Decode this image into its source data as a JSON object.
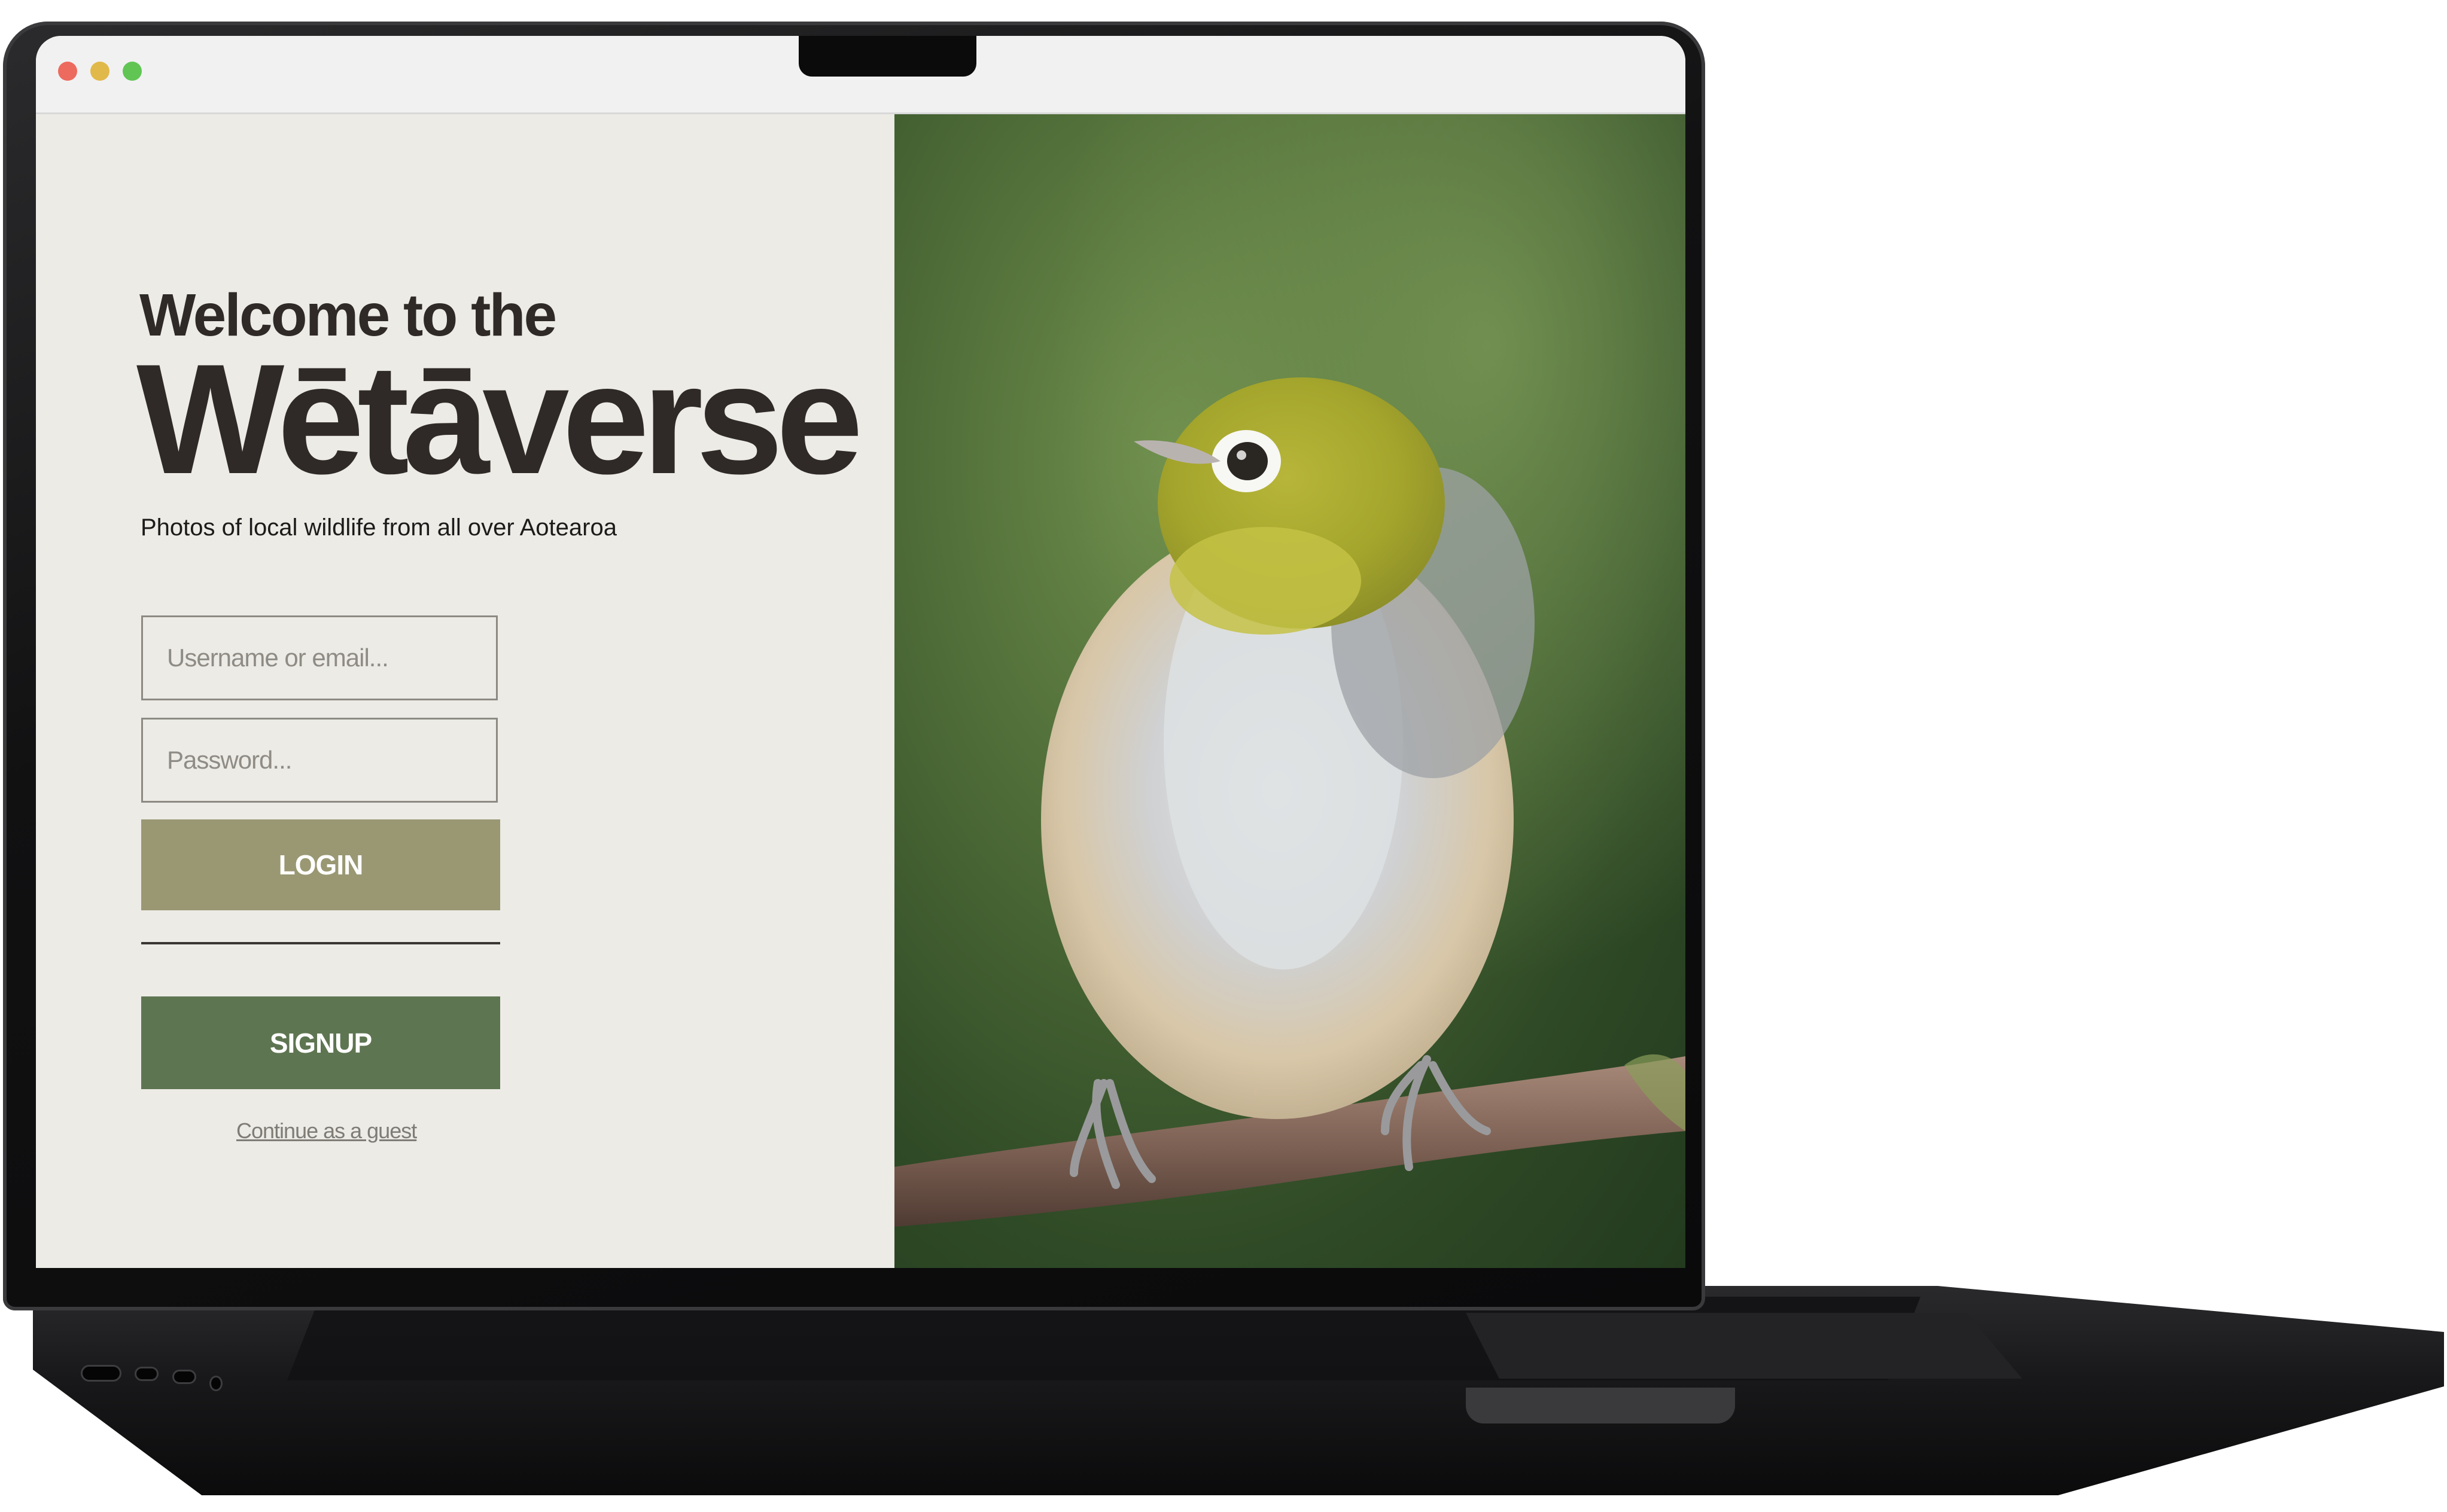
{
  "window": {
    "controls": [
      "close",
      "minimize",
      "maximize"
    ],
    "colors": {
      "close": "#ed6a5e",
      "minimize": "#e1b94a",
      "maximize": "#61c554"
    }
  },
  "login_panel": {
    "welcome_line": "Welcome to the",
    "brand_title": "Wētāverse",
    "tagline": "Photos of local wildlife from all over Aotearoa",
    "username_placeholder": "Username or email...",
    "password_placeholder": "Password...",
    "login_label": "LOGIN",
    "signup_label": "SIGNUP",
    "guest_link": "Continue as a guest"
  },
  "photo_panel": {
    "subject": "bird-on-branch"
  },
  "colors": {
    "panel_background": "#ecebe6",
    "text_dark": "#2f2a27",
    "login_button": "#999873",
    "signup_button": "#5e7551"
  }
}
